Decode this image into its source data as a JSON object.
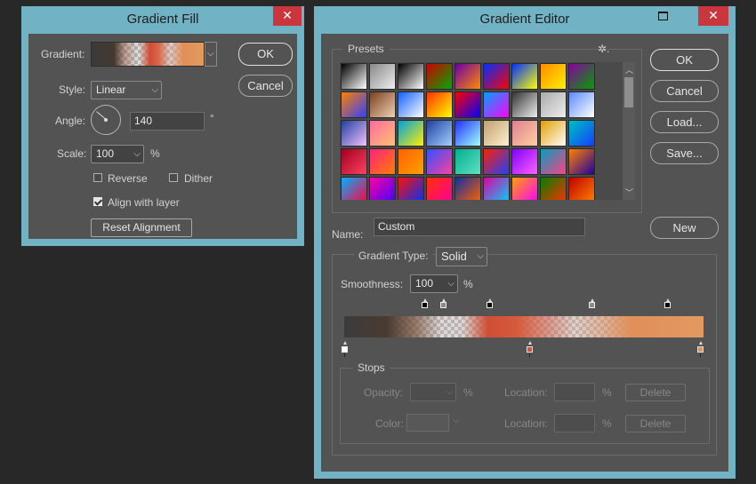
{
  "gradient_fill": {
    "title": "Gradient Fill",
    "close_glyph": "✕",
    "gradient_label": "Gradient:",
    "style_label": "Style:",
    "style_value": "Linear",
    "angle_label": "Angle:",
    "angle_value": "140",
    "degree_symbol": "°",
    "scale_label": "Scale:",
    "scale_value": "100",
    "percent": "%",
    "reverse_label": "Reverse",
    "reverse_checked": false,
    "dither_label": "Dither",
    "dither_checked": false,
    "align_label": "Align with layer",
    "align_checked": true,
    "reset_label": "Reset Alignment",
    "ok_label": "OK",
    "cancel_label": "Cancel"
  },
  "gradient_editor": {
    "title": "Gradient Editor",
    "minimize_glyph": "▭",
    "maximize_glyph": "□",
    "close_glyph": "✕",
    "presets_label": "Presets",
    "gear_glyph": "✲.",
    "ok_label": "OK",
    "cancel_label": "Cancel",
    "load_label": "Load...",
    "save_label": "Save...",
    "name_label": "Name:",
    "name_value": "Custom",
    "new_label": "New",
    "gradient_type_label": "Gradient Type:",
    "gradient_type_value": "Solid",
    "smoothness_label": "Smoothness:",
    "smoothness_value": "100",
    "percent": "%",
    "stops_label": "Stops",
    "opacity_label": "Opacity:",
    "color_label": "Color:",
    "location_label": "Location:",
    "delete_label": "Delete"
  },
  "colors": {
    "window_frame": "#71b3c5",
    "panel": "#535353",
    "close_red": "#c9363d",
    "gradient_dark": "#3a3a3a",
    "gradient_red": "#d2553a",
    "gradient_orange": "#e1935a"
  }
}
